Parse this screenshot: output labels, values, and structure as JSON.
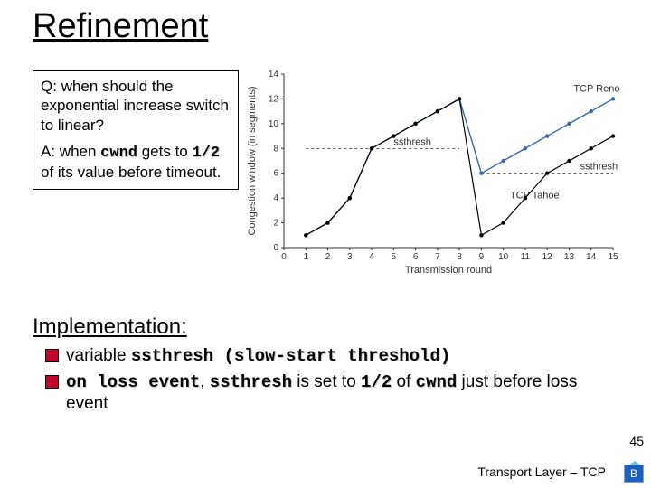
{
  "title": "Refinement",
  "qa": {
    "q_label": "Q:",
    "q_text": "when should the exponential increase switch to linear?",
    "a_label": "A:",
    "a_pre": "when ",
    "a_cwnd": "cwnd",
    "a_mid": " gets to ",
    "a_half": "1/2",
    "a_post": " of its value before timeout."
  },
  "impl": {
    "heading": "Implementation:",
    "b1_pre": "variable ",
    "b1_mono": "ssthresh (slow-start threshold)",
    "b2_onloss": "on loss event",
    "b2_co": ", ",
    "b2_ss": "ssthresh",
    "b2_mid": " is set to ",
    "b2_half": "1/2",
    "b2_of": " of ",
    "b2_cwnd": "cwnd",
    "b2_post": " just before loss event"
  },
  "footer": "Transport Layer – TCP",
  "pagenum": "45",
  "badge": "B",
  "chart_data": {
    "type": "line",
    "xlabel": "Transmission round",
    "ylabel": "Congestion window (in segments)",
    "xlim": [
      0,
      15
    ],
    "ylim": [
      0,
      14
    ],
    "xticks": [
      0,
      1,
      2,
      3,
      4,
      5,
      6,
      7,
      8,
      9,
      10,
      11,
      12,
      13,
      14,
      15
    ],
    "yticks": [
      0,
      2,
      4,
      6,
      8,
      10,
      12,
      14
    ],
    "series": [
      {
        "name": "TCP Reno",
        "x": [
          1,
          2,
          3,
          4,
          5,
          6,
          7,
          8,
          9,
          10,
          11,
          12,
          13,
          14,
          15
        ],
        "y": [
          1,
          2,
          4,
          8,
          9,
          10,
          11,
          12,
          6,
          7,
          8,
          9,
          10,
          11,
          12
        ]
      },
      {
        "name": "TCP Tahoe",
        "x": [
          1,
          2,
          3,
          4,
          5,
          6,
          7,
          8,
          9,
          10,
          11,
          12,
          13,
          14,
          15
        ],
        "y": [
          1,
          2,
          4,
          8,
          9,
          10,
          11,
          12,
          1,
          2,
          4,
          6,
          7,
          8,
          9
        ]
      }
    ],
    "annotations": [
      {
        "text": "ssthresh",
        "x": 5,
        "y": 8,
        "line_y": 8,
        "line_x": [
          1,
          8
        ]
      },
      {
        "text": "ssthresh",
        "x": 13.5,
        "y": 6,
        "line_y": 6,
        "line_x": [
          9,
          15
        ]
      },
      {
        "text": "TCP Reno",
        "x": 13.2,
        "y": 12.3
      },
      {
        "text": "TCP Tahoe",
        "x": 10.3,
        "y": 3.7
      }
    ]
  }
}
